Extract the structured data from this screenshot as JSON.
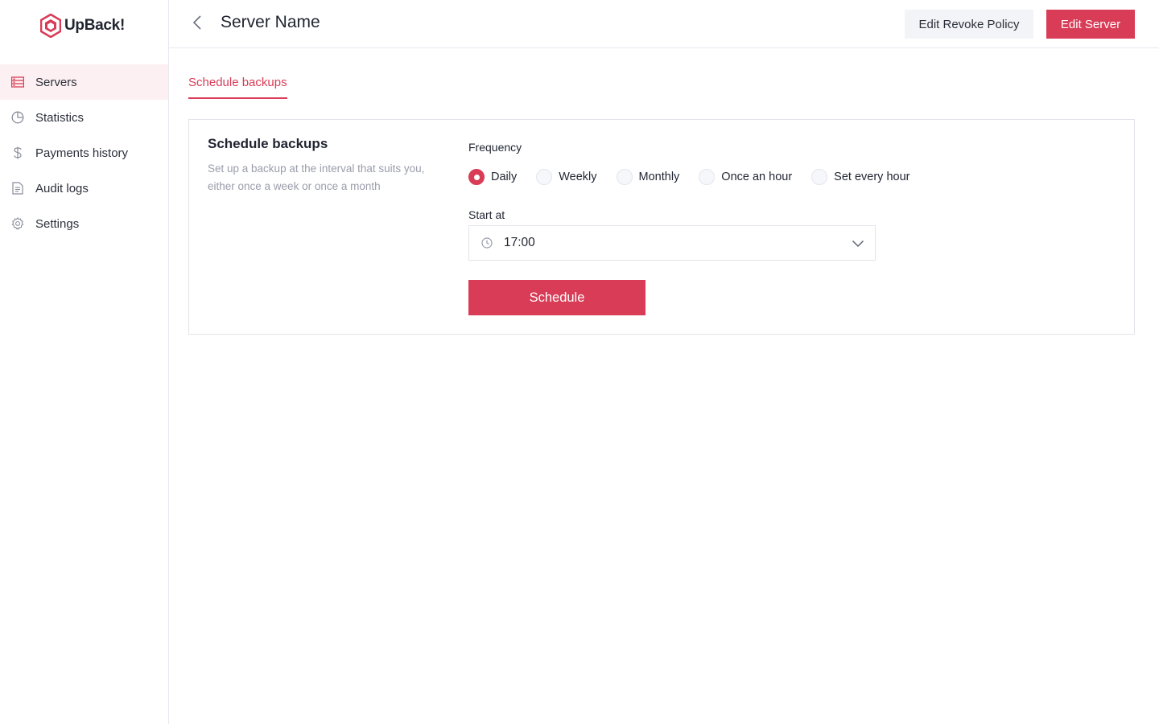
{
  "app": {
    "logo_text": "UpBack!",
    "accent_color": "#d93c56"
  },
  "sidebar": {
    "items": [
      {
        "label": "Servers",
        "icon": "server-list-icon",
        "active": true
      },
      {
        "label": "Statistics",
        "icon": "pie-chart-icon",
        "active": false
      },
      {
        "label": "Payments history",
        "icon": "dollar-icon",
        "active": false
      },
      {
        "label": "Audit logs",
        "icon": "document-icon",
        "active": false
      },
      {
        "label": "Settings",
        "icon": "gear-icon",
        "active": false
      }
    ]
  },
  "header": {
    "title": "Server Name",
    "revoke_label": "Edit Revoke Policy",
    "edit_label": "Edit Server"
  },
  "tabs": [
    {
      "label": "Schedule backups",
      "active": true
    }
  ],
  "card": {
    "title": "Schedule backups",
    "description": "Set up a backup at the interval that suits you, either once a week or once a month",
    "frequency_label": "Frequency",
    "frequency_options": [
      {
        "label": "Daily",
        "checked": true
      },
      {
        "label": "Weekly",
        "checked": false
      },
      {
        "label": "Monthly",
        "checked": false
      },
      {
        "label": "Once an hour",
        "checked": false
      },
      {
        "label": "Set every hour",
        "checked": false
      }
    ],
    "start_label": "Start at",
    "start_value": "17:00",
    "schedule_label": "Schedule"
  }
}
